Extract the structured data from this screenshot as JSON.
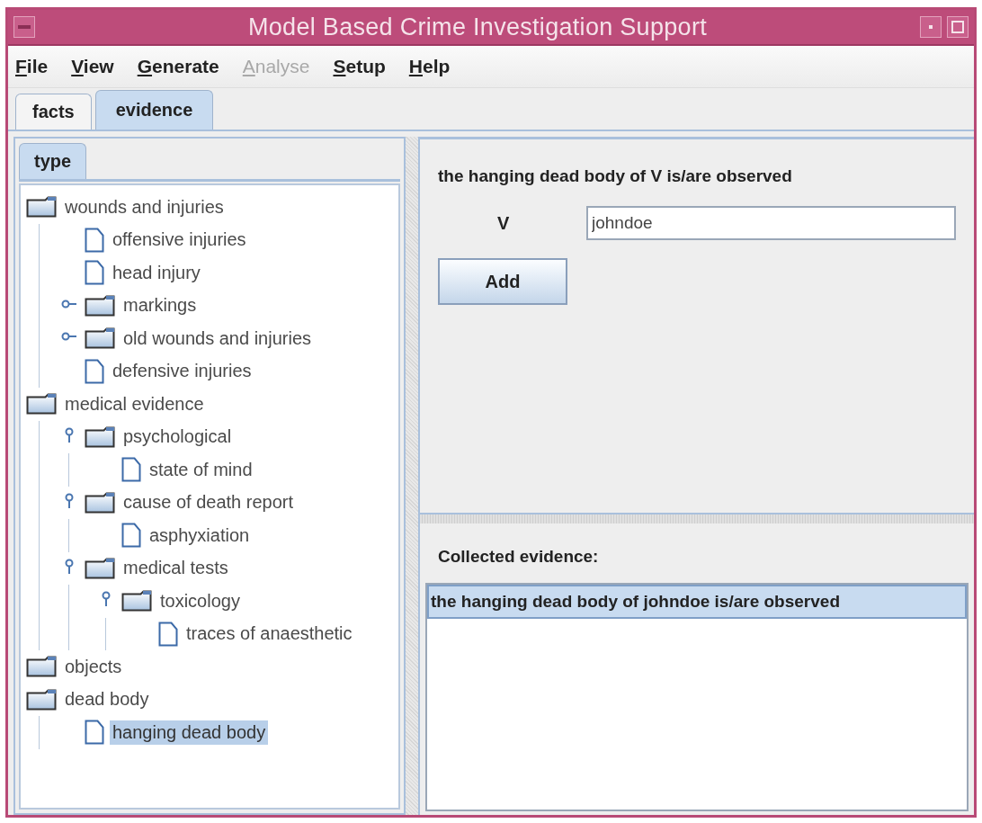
{
  "window": {
    "title": "Model Based Crime Investigation Support"
  },
  "menu": [
    {
      "label": "File",
      "disabled": false
    },
    {
      "label": "View",
      "disabled": false
    },
    {
      "label": "Generate",
      "disabled": false
    },
    {
      "label": "Analyse",
      "disabled": true
    },
    {
      "label": "Setup",
      "disabled": false
    },
    {
      "label": "Help",
      "disabled": false
    }
  ],
  "tabs": [
    {
      "label": "facts",
      "selected": false
    },
    {
      "label": "evidence",
      "selected": true
    }
  ],
  "tree_tabs": [
    {
      "label": "type",
      "selected": true
    }
  ],
  "tree": [
    {
      "label": "wounds and injuries",
      "kind": "folder",
      "selected": false,
      "children": [
        {
          "label": "offensive injuries",
          "kind": "leaf",
          "selected": false
        },
        {
          "label": "head injury",
          "kind": "leaf",
          "selected": false
        },
        {
          "label": "markings",
          "kind": "folder",
          "expanded": false,
          "selected": false
        },
        {
          "label": "old wounds and injuries",
          "kind": "folder",
          "expanded": false,
          "selected": false
        },
        {
          "label": "defensive injuries",
          "kind": "leaf",
          "selected": false
        }
      ]
    },
    {
      "label": "medical evidence",
      "kind": "folder",
      "selected": false,
      "children": [
        {
          "label": "psychological",
          "kind": "folder",
          "expanded": true,
          "selected": false,
          "children": [
            {
              "label": "state of mind",
              "kind": "leaf",
              "selected": false
            }
          ]
        },
        {
          "label": "cause of death report",
          "kind": "folder",
          "expanded": true,
          "selected": false,
          "children": [
            {
              "label": "asphyxiation",
              "kind": "leaf",
              "selected": false
            }
          ]
        },
        {
          "label": "medical tests",
          "kind": "folder",
          "expanded": true,
          "selected": false,
          "children": [
            {
              "label": "toxicology",
              "kind": "folder",
              "expanded": true,
              "selected": false,
              "children": [
                {
                  "label": "traces of anaesthetic",
                  "kind": "leaf",
                  "selected": false
                }
              ]
            }
          ]
        }
      ]
    },
    {
      "label": "objects",
      "kind": "folder",
      "selected": false
    },
    {
      "label": "dead body",
      "kind": "folder",
      "selected": false,
      "children": [
        {
          "label": "hanging dead body",
          "kind": "leaf",
          "selected": true
        }
      ]
    }
  ],
  "form": {
    "statement": "the hanging dead body of V is/are observed",
    "variable": "V",
    "value": "johndoe",
    "button": "Add"
  },
  "collected": {
    "heading": "Collected evidence:",
    "items": [
      {
        "label": "the hanging dead body of johndoe is/are observed",
        "selected": true
      }
    ]
  }
}
